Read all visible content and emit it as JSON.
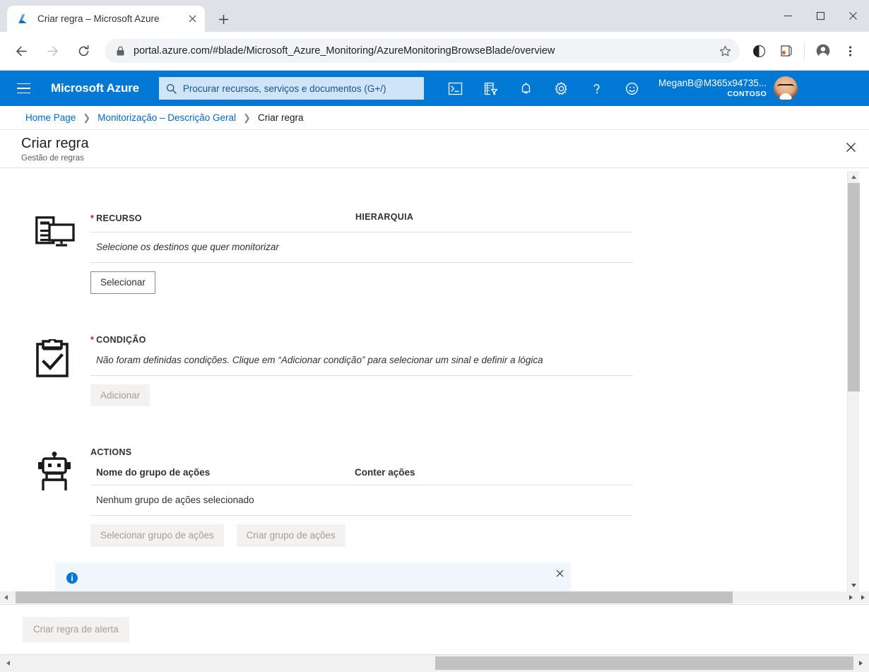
{
  "browser": {
    "tab": {
      "title": "Criar regra – Microsoft Azure",
      "favicon_name": "azure-logo-icon",
      "close_label": "✕"
    },
    "new_tab_label": "+",
    "window_controls": {
      "minimize": "—",
      "maximize": "▢",
      "close": "✕"
    },
    "nav": {
      "back": "←",
      "forward": "→",
      "reload": "⟳"
    },
    "omnibox": {
      "url": "portal.azure.com/#blade/Microsoft_Azure_Monitoring/AzureMonitoringBrowseBlade/overview",
      "lock_icon": "lock-icon",
      "star_icon": "bookmark-star-icon"
    },
    "toolbar_icons": [
      "contrast-icon",
      "extension-icon",
      "profile-avatar-icon",
      "more-menu-icon"
    ]
  },
  "azure_bar": {
    "menu_icon": "hamburger-menu-icon",
    "brand": "Microsoft Azure",
    "search_placeholder": "Procurar recursos, serviços e documentos (G+/)",
    "icons": [
      "cloud-shell-icon",
      "directories-filter-icon",
      "notifications-bell-icon",
      "settings-gear-icon",
      "help-question-icon",
      "feedback-smiley-icon"
    ],
    "user_name": "MeganB@M365x94735...",
    "user_org": "CONTOSO"
  },
  "breadcrumb": {
    "items": [
      {
        "label": "Home Page",
        "current": false
      },
      {
        "label": "Monitorização – Descrição Geral",
        "current": false
      },
      {
        "label": "Criar regra",
        "current": true
      }
    ],
    "separator": "❯"
  },
  "blade": {
    "title": "Criar regra",
    "subtitle": "Gestão de regras",
    "close_label": "✕"
  },
  "resource_section": {
    "icon_name": "server-monitor-icon",
    "required_marker": "*",
    "label": "RECURSO",
    "hierarchy_label": "HIERARQUIA",
    "empty_text": "Selecione os destinos que quer monitorizar",
    "select_button": "Selecionar"
  },
  "condition_section": {
    "icon_name": "clipboard-check-icon",
    "required_marker": "*",
    "label": "CONDIÇÃO",
    "empty_text": "Não foram definidas condições. Clique em “Adicionar condição” para selecionar um sinal e definir a lógica",
    "add_button": "Adicionar"
  },
  "actions_section": {
    "icon_name": "robot-icon",
    "label": "ACTIONS",
    "col_name": "Nome do grupo de ações",
    "col_count": "Conter ações",
    "empty_text": "Nenhum grupo de ações selecionado",
    "select_group_button": "Selecionar grupo de ações",
    "create_group_button": "Criar grupo de ações"
  },
  "info_banner": {
    "icon_name": "info-circle-icon",
    "icon_glyph": "i",
    "text": "",
    "close_label": "✕",
    "background": "#eff6fc",
    "accent": "#0078d4"
  },
  "footer": {
    "create_alert_rule_button": "Criar regra de alerta"
  },
  "scrollbars": {
    "vertical_up": "▲",
    "vertical_down": "▼",
    "horizontal_left": "◀",
    "horizontal_right": "▶"
  },
  "colors": {
    "azure_blue": "#0078d4",
    "link_blue": "#0066cc",
    "required_red": "#a4262c",
    "text": "#323130"
  }
}
